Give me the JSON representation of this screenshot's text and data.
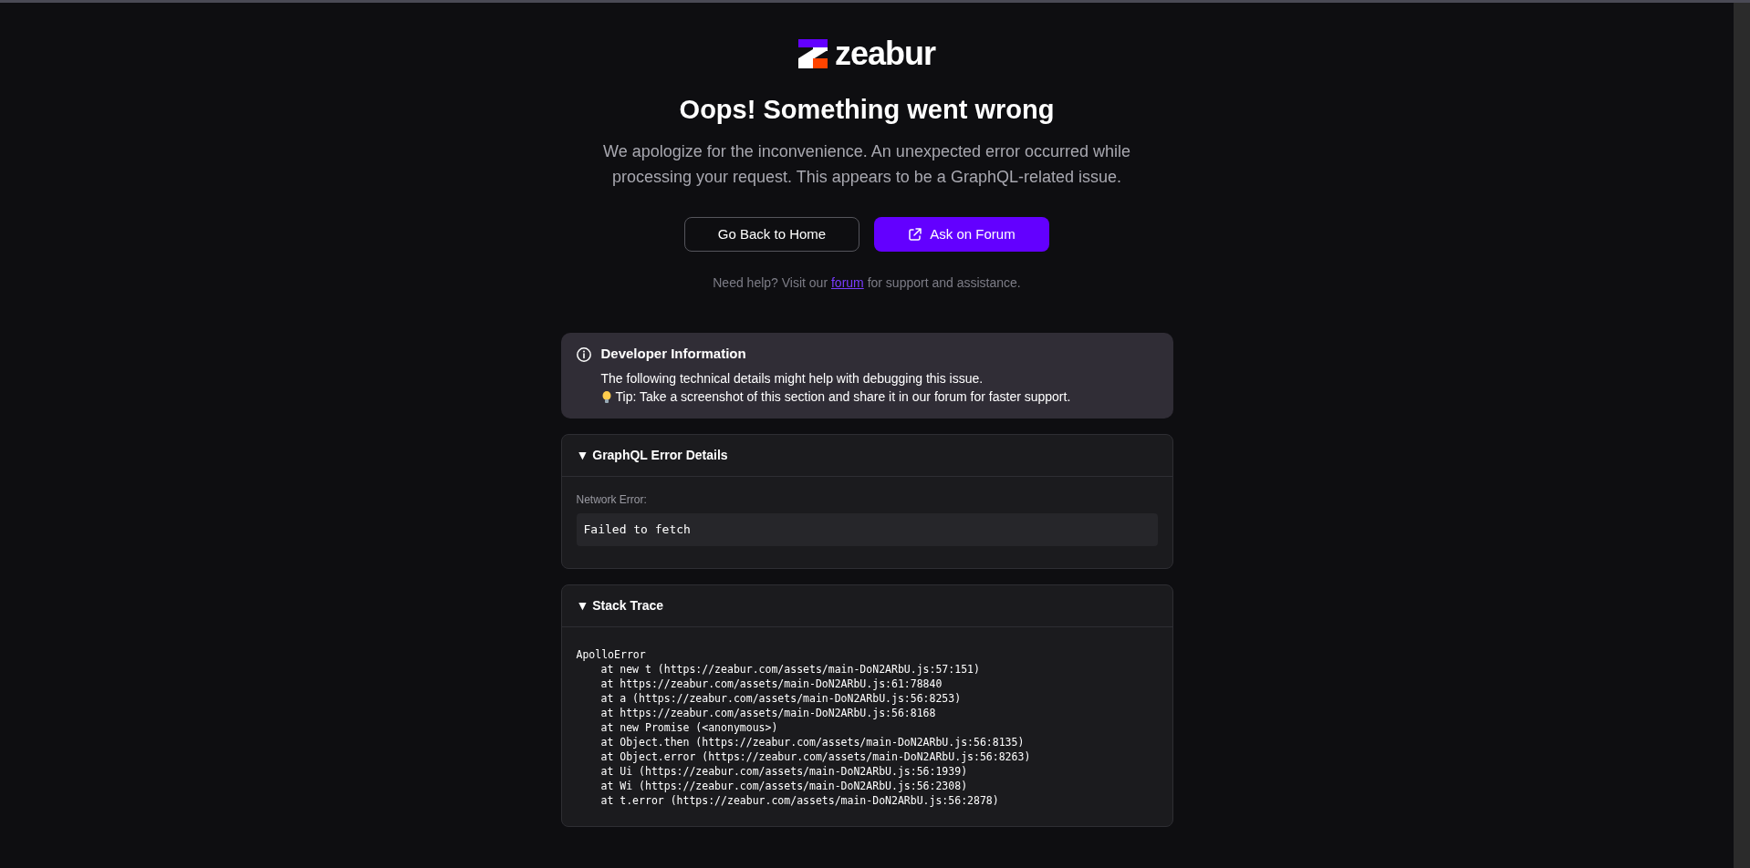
{
  "logo": {
    "text": "zeabur"
  },
  "title": "Oops! Something went wrong",
  "message": "We apologize for the inconvenience. An unexpected error occurred while processing your request. This appears to be a GraphQL-related issue.",
  "buttons": [
    {
      "label": "Go Back to Home",
      "kind": "outline"
    },
    {
      "label": "Ask on Forum",
      "kind": "primary"
    }
  ],
  "help": {
    "before": "Need help? Visit our",
    "link": "forum",
    "after": "for support and assistance."
  },
  "developer_info": {
    "title": "Developer Information",
    "text": "The following technical details might help with debugging this issue.",
    "tip": "Tip: Take a screenshot of this section and share it in our forum for faster support."
  },
  "sections": [
    {
      "marker": "▼",
      "title": "GraphQL Error Details",
      "expanded": true,
      "kind": "error",
      "label": "Network Error:",
      "value": "Failed to fetch"
    },
    {
      "marker": "▼",
      "title": "Stack Trace",
      "expanded": true,
      "kind": "trace",
      "error": "ApolloError",
      "frames": [
        "at new t (https://zeabur.com/assets/main-DoN2ARbU.js:57:151)",
        "at https://zeabur.com/assets/main-DoN2ARbU.js:61:78840",
        "at a (https://zeabur.com/assets/main-DoN2ARbU.js:56:8253)",
        "at https://zeabur.com/assets/main-DoN2ARbU.js:56:8168",
        "at new Promise (<anonymous>)",
        "at Object.then (https://zeabur.com/assets/main-DoN2ARbU.js:56:8135)",
        "at Object.error (https://zeabur.com/assets/main-DoN2ARbU.js:56:8263)",
        "at Ui (https://zeabur.com/assets/main-DoN2ARbU.js:56:1939)",
        "at Wi (https://zeabur.com/assets/main-DoN2ARbU.js:56:2308)",
        "at t.error (https://zeabur.com/assets/main-DoN2ARbU.js:56:2878)"
      ]
    }
  ]
}
